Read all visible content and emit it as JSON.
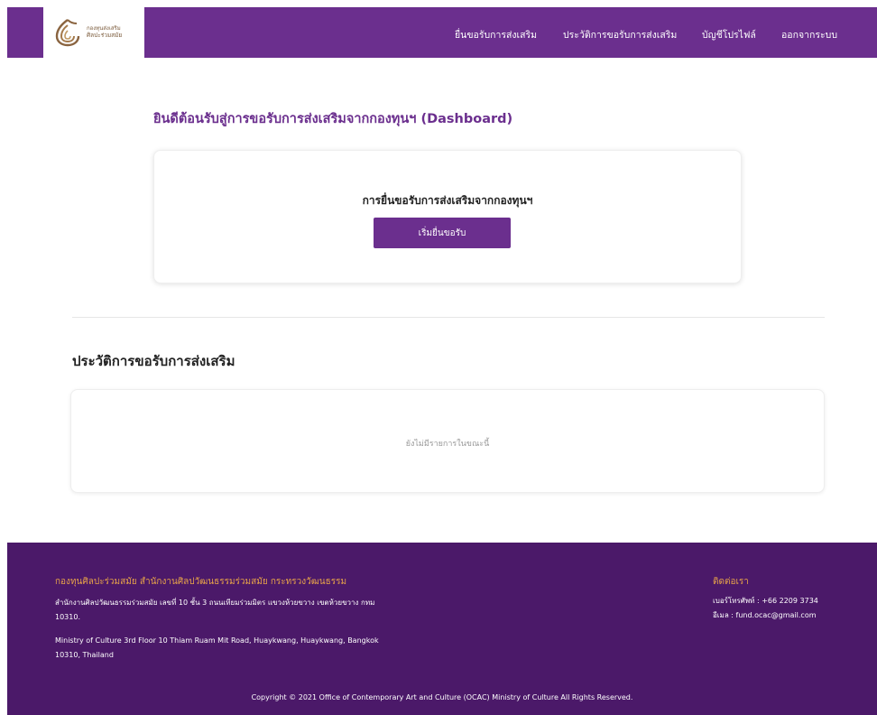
{
  "navbar": {
    "logo_text_line1": "กองทุนส่งเสริม",
    "logo_text_line2": "ศิลปะร่วมสมัย",
    "items": [
      {
        "label": "ยื่นขอรับการส่งเสริม"
      },
      {
        "label": "ประวัติการขอรับการส่งเสริม"
      },
      {
        "label": "บัญชีโปรไฟล์"
      },
      {
        "label": "ออกจากระบบ"
      }
    ]
  },
  "main": {
    "welcome_title": "ยินดีต้อนรับสู่การขอรับการส่งเสริมจากกองทุนฯ (Dashboard)",
    "apply_card": {
      "title": "การยื่นขอรับการส่งเสริมจากกองทุนฯ",
      "button_label": "เริ่มยื่นขอรับ"
    },
    "history": {
      "title": "ประวัติการขอรับการส่งเสริม",
      "empty_text": "ยังไม่มีรายการในขณะนี้"
    }
  },
  "footer": {
    "org_title": "กองทุนศิลปะร่วมสมัย สำนักงานศิลปวัฒนธรรมร่วมสมัย กระทรวงวัฒนธรรม",
    "address_th": "สำนักงานศิลปวัฒนธรรมร่วมสมัย เลขที่ 10 ชั้น 3 ถนนเทียมร่วมมิตร แขวงห้วยขวาง เขตห้วยขวาง กทม 10310.",
    "address_en": "Ministry of Culture 3rd Floor 10 Thiam Ruam Mit Road, Huaykwang, Huaykwang, Bangkok 10310, Thailand",
    "contact_title": "ติดต่อเรา",
    "phone": "เบอร์โทรศัพท์ : +66 2209 3734",
    "email": "อีเมล : fund.ocac@gmail.com",
    "copyright": "Copyright © 2021 Office of Contemporary Art and Culture (OCAC) Ministry of Culture All Rights Reserved."
  },
  "colors": {
    "brand_purple": "#6b2f8e",
    "footer_purple": "#4b1969",
    "footer_accent": "#e7a349"
  }
}
